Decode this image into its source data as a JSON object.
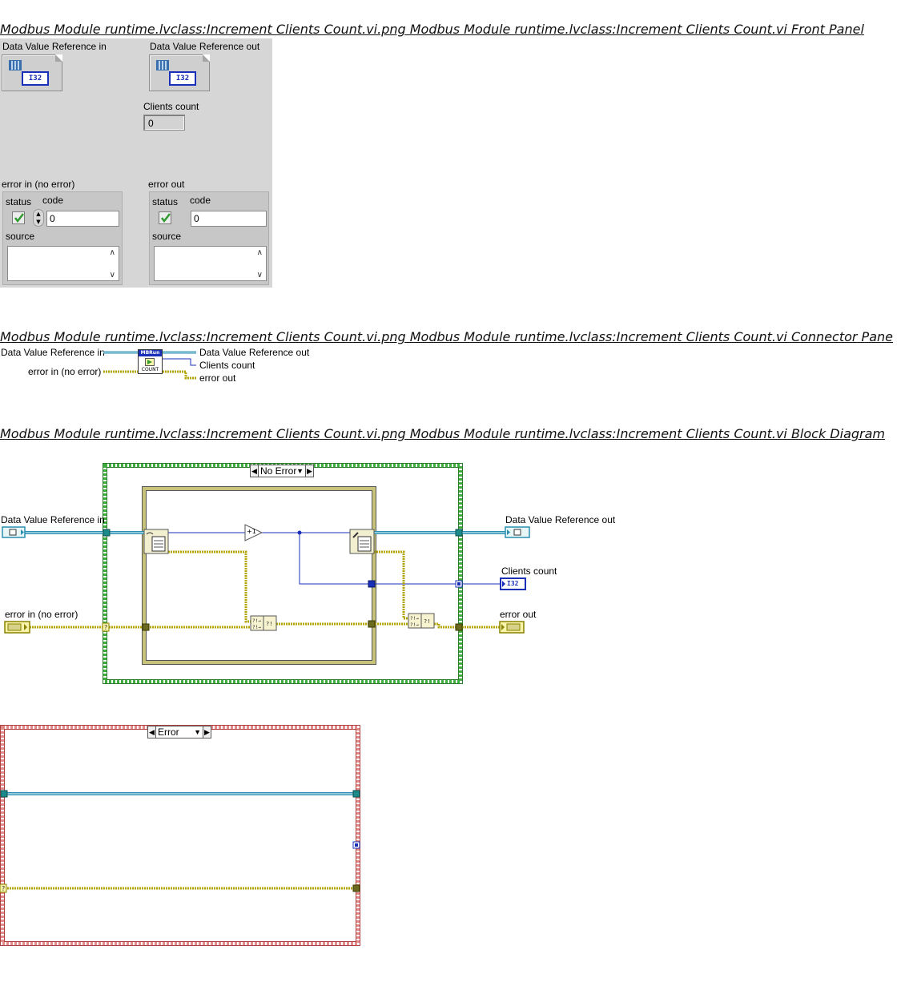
{
  "headings": {
    "front_panel": "Modbus Module runtime.lvclass:Increment Clients Count.vi.png  Modbus Module runtime.lvclass:Increment Clients Count.vi Front Panel",
    "connector_pane": "Modbus Module runtime.lvclass:Increment Clients Count.vi.png  Modbus Module runtime.lvclass:Increment Clients Count.vi Connector Pane",
    "block_diagram": "Modbus Module runtime.lvclass:Increment Clients Count.vi.png  Modbus Module runtime.lvclass:Increment Clients Count.vi Block Diagram"
  },
  "front_panel": {
    "dvr_in_label": "Data Value Reference in",
    "dvr_out_label": "Data Value Reference out",
    "dvr_type": "I32",
    "clients_count_label": "Clients count",
    "clients_count_value": "0",
    "error_in": {
      "label": "error in (no error)",
      "status_label": "status",
      "code_label": "code",
      "code_value": "0",
      "source_label": "source"
    },
    "error_out": {
      "label": "error out",
      "status_label": "status",
      "code_label": "code",
      "code_value": "0",
      "source_label": "source"
    }
  },
  "connector_pane": {
    "dvr_in": "Data Value Reference in",
    "error_in": "error in (no error)",
    "dvr_out": "Data Value Reference out",
    "clients_count": "Clients count",
    "error_out": "error out",
    "icon_top": "MBRun",
    "icon_bottom": "COUNT"
  },
  "block_diagram": {
    "case_no_error": "No Error",
    "case_error": "Error",
    "dvr_in": "Data Value Reference in",
    "error_in": "error in (no error)",
    "dvr_out": "Data Value Reference out",
    "clients_count": "Clients count",
    "error_out": "error out",
    "increment_label": "+1",
    "clients_count_type": "I32"
  },
  "colors": {
    "dvr_wire": "#2a8fb0",
    "error_wire": "#b3a400",
    "number_wire": "#1a2fb8",
    "case_no_error_border": "#3fae3f",
    "case_error_border": "#d9534f",
    "ipe_border": "#8c8a4a",
    "panel_bg": "#d6d6d6"
  }
}
